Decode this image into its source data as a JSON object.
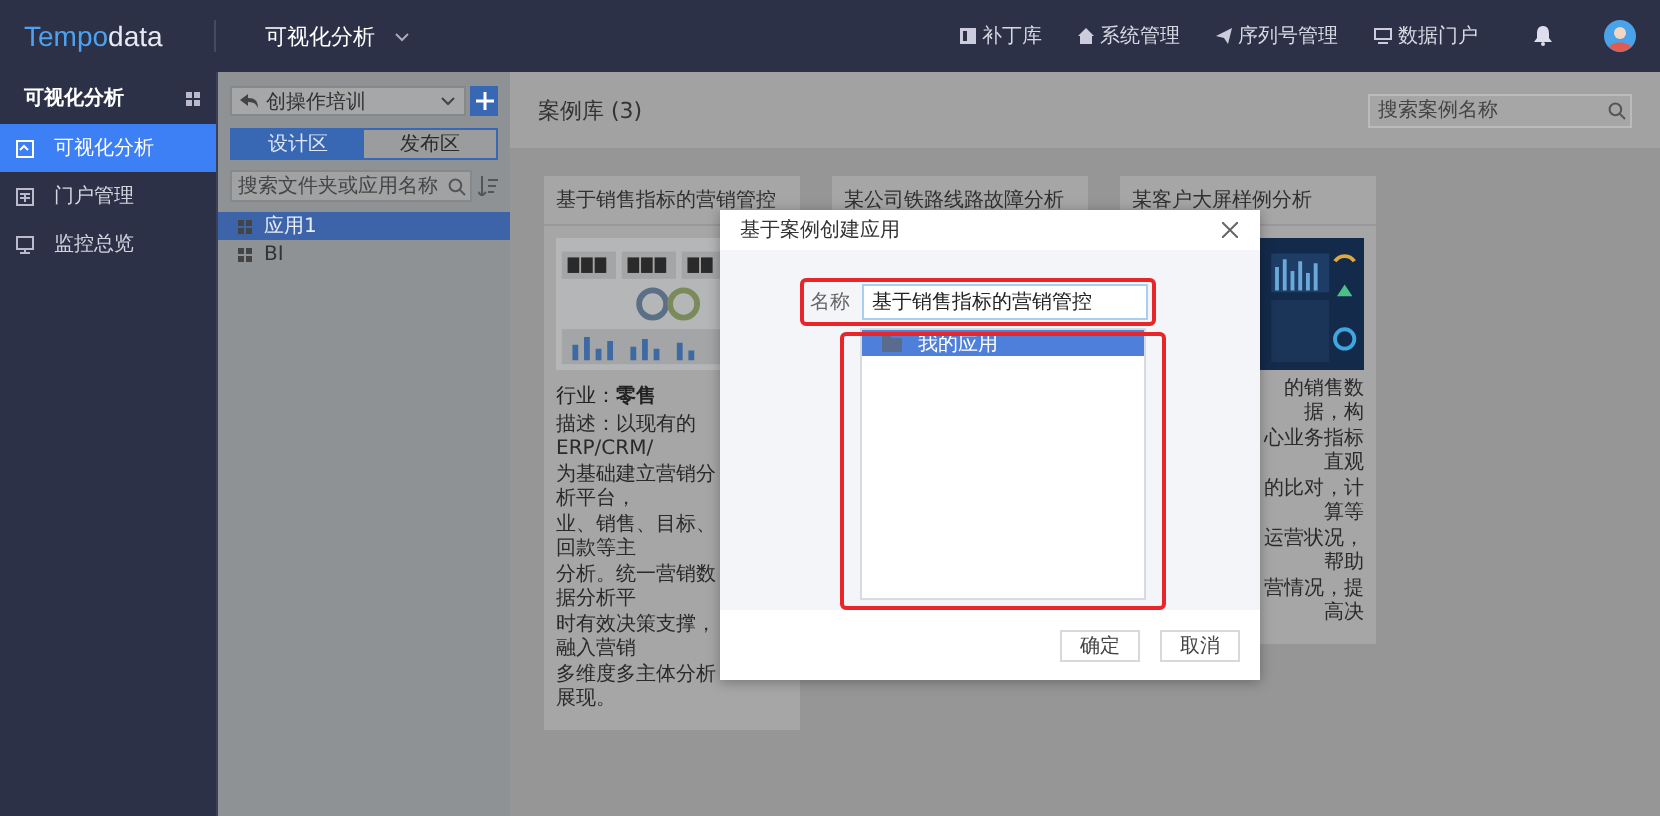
{
  "topbar": {
    "logo": {
      "first": "Tempo",
      "second": "data"
    },
    "module": "可视化分析",
    "nav": [
      {
        "label": "补丁库",
        "kind": "book"
      },
      {
        "label": "系统管理",
        "kind": "home"
      },
      {
        "label": "序列号管理",
        "kind": "send"
      },
      {
        "label": "数据门户",
        "kind": "monitor"
      }
    ]
  },
  "sidebar": {
    "title": "可视化分析",
    "items": [
      {
        "label": "可视化分析",
        "kind": "chart",
        "selected": true
      },
      {
        "label": "门户管理",
        "kind": "portal",
        "selected": false
      },
      {
        "label": "监控总览",
        "kind": "monitor",
        "selected": false
      }
    ]
  },
  "panel": {
    "dropdown": {
      "value": "创操作培训"
    },
    "tabs": [
      {
        "label": "设计区",
        "selected": true
      },
      {
        "label": "发布区",
        "selected": false
      }
    ],
    "search": {
      "placeholder": "搜索文件夹或应用名称"
    },
    "tree": [
      {
        "label": "应用1",
        "selected": true
      },
      {
        "label": "BI",
        "selected": false
      }
    ]
  },
  "main": {
    "title": "案例库 (3)",
    "search": {
      "placeholder": "搜索案例名称"
    },
    "cards": [
      {
        "title": "基于销售指标的营销管控",
        "kind": "light",
        "industry": "行业：**零售**",
        "description": [
          "描述：以现有的ERP/CRM/",
          "为基础建立营销分析平台，",
          "业、销售、目标、回款等主",
          "分析。统一营销数据分析平",
          "时有效决策支撑，融入营销",
          "多维度多主体分析展现。"
        ]
      },
      {
        "title": "某公司铁路线路故障分析"
      },
      {
        "title": "某客户大屏样例分析",
        "kind": "dark",
        "description": [
          "的销售数据，构",
          "心业务指标直观",
          "的比对，计算等",
          "运营状况，帮助",
          "营情况，提高决"
        ]
      }
    ]
  },
  "modal": {
    "title": "基于案例创建应用",
    "name": {
      "label": "名称",
      "value": "基于销售指标的营销管控"
    },
    "tree": [
      {
        "label": "我的应用",
        "selected": true
      }
    ],
    "buttons": [
      {
        "label": "确定"
      },
      {
        "label": "取消"
      }
    ]
  }
}
